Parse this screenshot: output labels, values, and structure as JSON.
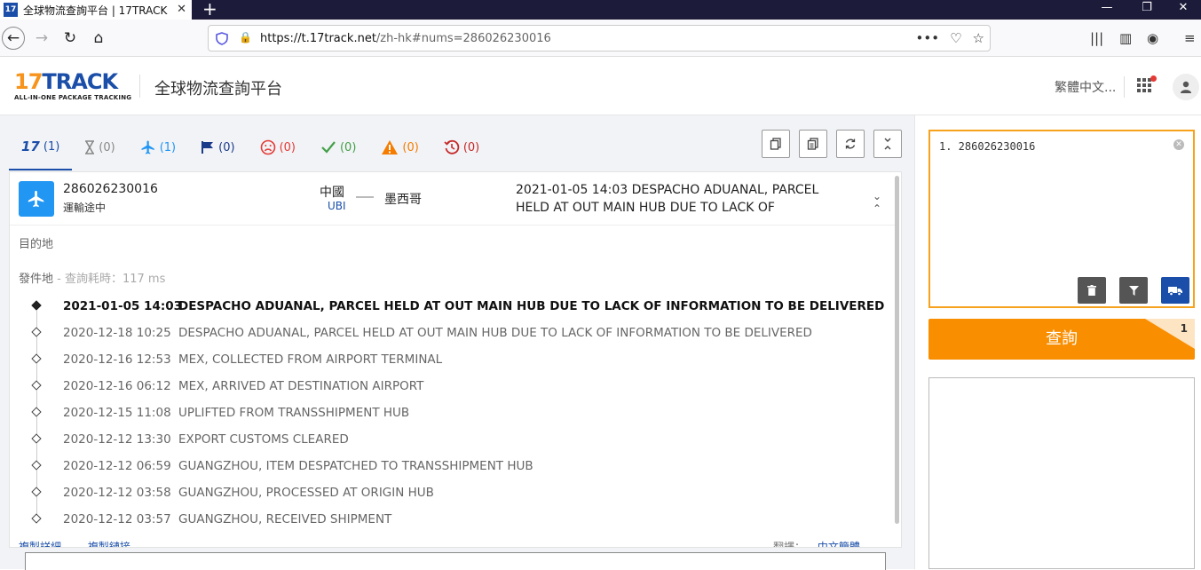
{
  "browser": {
    "tab_title": "全球物流查詢平台 | 17TRACK",
    "favicon_text": "17",
    "new_tab": "+",
    "url_host": "https://t.17track.net",
    "url_path": "/zh-hk#nums=286026230016"
  },
  "header": {
    "logo_main_a": "17",
    "logo_main_b": "TRACK",
    "logo_sub": "ALL-IN-ONE PACKAGE TRACKING",
    "site_title": "全球物流查詢平台",
    "language": "繁體中文..."
  },
  "status_tabs": [
    {
      "icon": "17track-logo-icon",
      "count": "(1)",
      "color": "#1a4ea8"
    },
    {
      "icon": "hourglass-icon",
      "count": "(0)",
      "color": "#888888"
    },
    {
      "icon": "airplane-icon",
      "count": "(1)",
      "color": "#2196f3"
    },
    {
      "icon": "flag-icon",
      "count": "(0)",
      "color": "#1a3a8a"
    },
    {
      "icon": "sad-face-icon",
      "count": "(0)",
      "color": "#e53935"
    },
    {
      "icon": "check-icon",
      "count": "(0)",
      "color": "#43a047"
    },
    {
      "icon": "warning-icon",
      "count": "(0)",
      "color": "#f57c00"
    },
    {
      "icon": "expired-clock-icon",
      "count": "(0)",
      "color": "#c62828"
    }
  ],
  "shipment": {
    "tracking_number": "286026230016",
    "status": "運輸途中",
    "origin": "中國",
    "carrier": "UBI",
    "destination": "墨西哥",
    "latest_event": "2021-01-05 14:03  DESPACHO ADUANAL, PARCEL HELD AT OUT MAIN HUB DUE TO LACK OF INFORMATION TO BE..."
  },
  "labels": {
    "destination_section": "目的地",
    "origin_section": "發件地",
    "query_time": " - 查詢耗時：117 ms"
  },
  "events": [
    {
      "date": "2021-01-05 14:03",
      "text": "DESPACHO ADUANAL, PARCEL HELD AT OUT MAIN HUB DUE TO LACK OF INFORMATION TO BE DELIVERED"
    },
    {
      "date": "2020-12-18 10:25",
      "text": "DESPACHO ADUANAL, PARCEL HELD AT OUT MAIN HUB DUE TO LACK OF INFORMATION TO BE DELIVERED"
    },
    {
      "date": "2020-12-16 12:53",
      "text": "MEX, COLLECTED FROM AIRPORT TERMINAL"
    },
    {
      "date": "2020-12-16 06:12",
      "text": "MEX, ARRIVED AT DESTINATION AIRPORT"
    },
    {
      "date": "2020-12-15 11:08",
      "text": "UPLIFTED FROM TRANSSHIPMENT HUB"
    },
    {
      "date": "2020-12-12 13:30",
      "text": "EXPORT CUSTOMS CLEARED"
    },
    {
      "date": "2020-12-12 06:59",
      "text": "GUANGZHOU, ITEM DESPATCHED TO TRANSSHIPMENT HUB"
    },
    {
      "date": "2020-12-12 03:58",
      "text": "GUANGZHOU, PROCESSED AT ORIGIN HUB"
    },
    {
      "date": "2020-12-12 03:57",
      "text": "GUANGZHOU, RECEIVED SHIPMENT"
    }
  ],
  "footer": {
    "link1": "複製詳細",
    "link2": "複製鏈接",
    "translate_label": "翻譯：",
    "translate_value": "中文簡體"
  },
  "sidebar": {
    "input_text": "1. 286026230016",
    "query_button": "查詢",
    "query_count": "1"
  }
}
